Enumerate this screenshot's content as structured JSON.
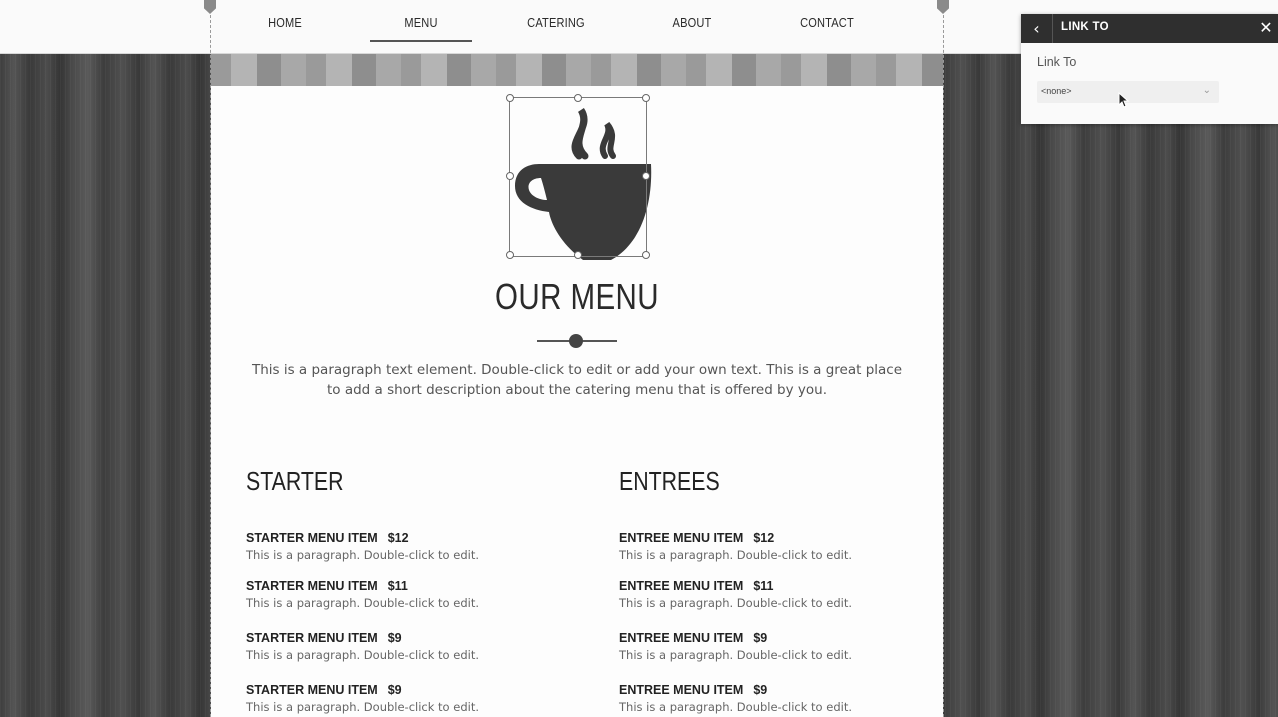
{
  "nav": {
    "items": [
      {
        "label": "HOME",
        "active": false
      },
      {
        "label": "MENU",
        "active": true
      },
      {
        "label": "CATERING",
        "active": false
      },
      {
        "label": "ABOUT",
        "active": false
      },
      {
        "label": "CONTACT",
        "active": false
      }
    ]
  },
  "page": {
    "title": "OUR MENU",
    "intro": "This is a paragraph text element. Double-click to edit or add your own text. This is a great place to add a short description about the catering menu that is offered by you."
  },
  "starter": {
    "title": "STARTER",
    "items": [
      {
        "name": "STARTER MENU ITEM",
        "price": "$12",
        "desc": "This is a paragraph. Double-click to edit."
      },
      {
        "name": "STARTER MENU ITEM",
        "price": "$11",
        "desc": "This is a paragraph. Double-click to edit."
      },
      {
        "name": "STARTER MENU ITEM",
        "price": "$9",
        "desc": "This is a paragraph. Double-click to edit."
      },
      {
        "name": "STARTER MENU ITEM",
        "price": "$9",
        "desc": "This is a paragraph. Double-click to edit."
      }
    ]
  },
  "entrees": {
    "title": "ENTREES",
    "items": [
      {
        "name": "ENTREE MENU ITEM",
        "price": "$12",
        "desc": "This is a paragraph. Double-click to edit."
      },
      {
        "name": "ENTREE MENU ITEM",
        "price": "$11",
        "desc": "This is a paragraph. Double-click to edit."
      },
      {
        "name": "ENTREE MENU ITEM",
        "price": "$9",
        "desc": "This is a paragraph. Double-click to edit."
      },
      {
        "name": "ENTREE MENU ITEM",
        "price": "$9",
        "desc": "This is a paragraph. Double-click to edit."
      }
    ]
  },
  "panel": {
    "title": "LINK TO",
    "back_icon": "chevron-left-icon",
    "close_icon": "close-icon",
    "label": "Link To",
    "select_value": "<none>"
  },
  "colors": {
    "panel_header": "#2f2f2f",
    "page_bg": "#fdfdfd",
    "text_dark": "#222222"
  }
}
